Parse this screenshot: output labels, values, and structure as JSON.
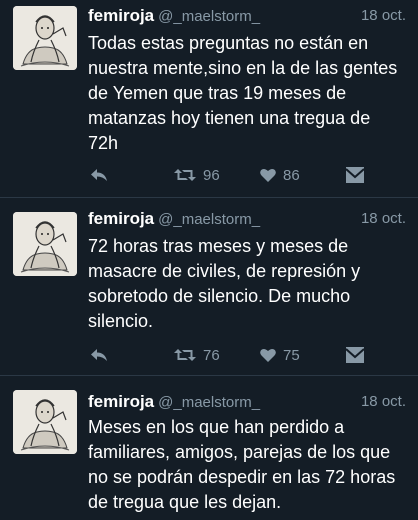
{
  "tweets": [
    {
      "name": "femiroja",
      "handle": "@_maelstorm_",
      "time": "18 oct.",
      "text": "Todas estas preguntas no están en\nnuestra mente,sino en la de las gentes\nde Yemen que tras 19 meses de\nmatanzas hoy tienen una tregua de\n72h",
      "retweets": "96",
      "likes": "86"
    },
    {
      "name": "femiroja",
      "handle": "@_maelstorm_",
      "time": "18 oct.",
      "text": "72 horas tras meses y meses de\nmasacre de civiles, de represión y\nsobretodo de silencio. De mucho\nsilencio.",
      "retweets": "76",
      "likes": "75"
    },
    {
      "name": "femiroja",
      "handle": "@_maelstorm_",
      "time": "18 oct.",
      "text": "Meses en los que han perdido a\nfamiliares, amigos, parejas de los que\nno se podrán despedir en las 72 horas\nde tregua que les dejan."
    }
  ],
  "icons": {
    "reply": "reply-icon",
    "retweet": "retweet-icon",
    "like": "heart-icon",
    "dm": "direct-message-icon"
  },
  "colors": {
    "background": "#141d26",
    "secondary_text": "#8899a6",
    "divider": "#2b3845"
  }
}
